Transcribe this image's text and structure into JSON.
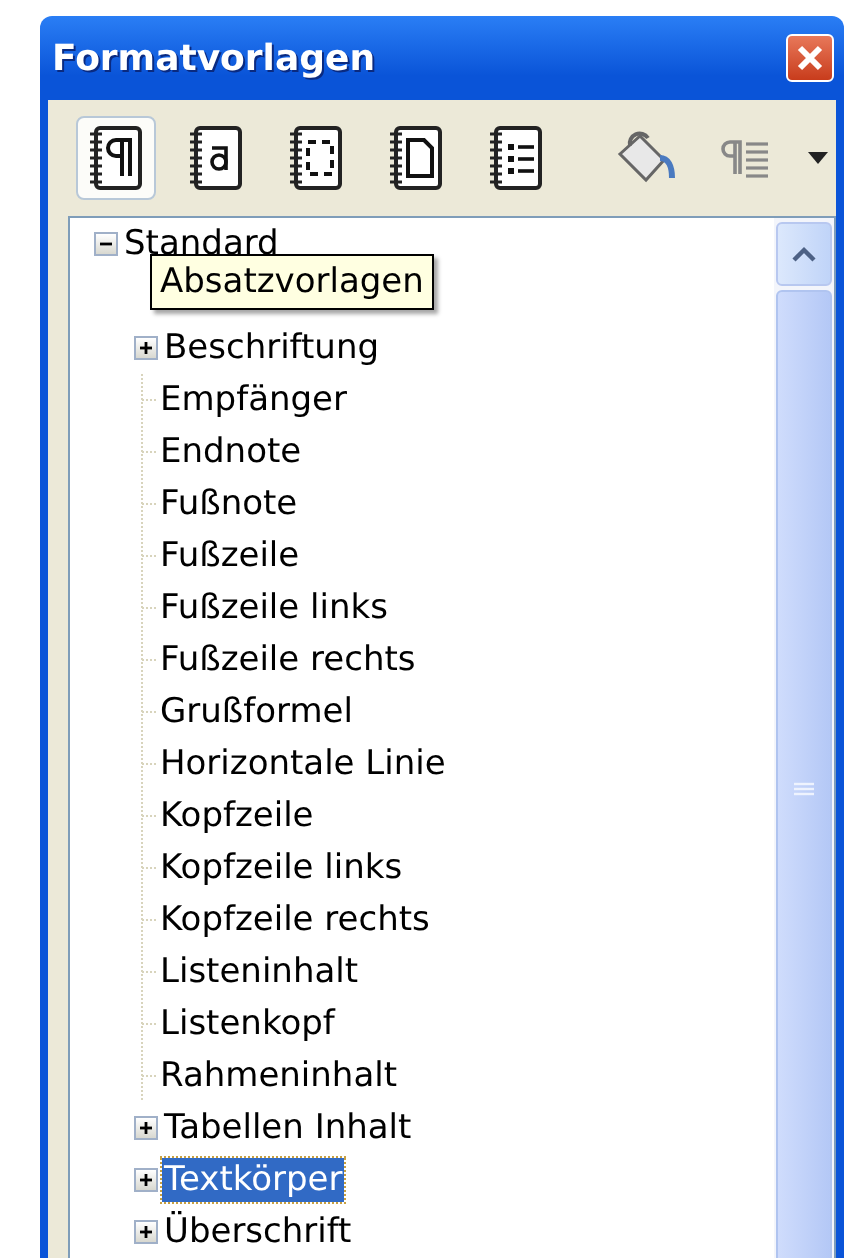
{
  "window": {
    "title": "Formatvorlagen"
  },
  "style_families": [
    {
      "kind": "paragraph",
      "selected": true
    },
    {
      "kind": "character",
      "selected": false
    },
    {
      "kind": "frame",
      "selected": false
    },
    {
      "kind": "page",
      "selected": false
    },
    {
      "kind": "list",
      "selected": false
    }
  ],
  "actions": [
    {
      "kind": "fill"
    },
    {
      "kind": "new"
    },
    {
      "kind": "menu"
    }
  ],
  "tooltip": {
    "text": "Absatzvorlagen"
  },
  "tree": [
    {
      "label": "Standard",
      "expandable": true,
      "expanded": true,
      "selected": false,
      "children": [
        {
          "label": "Beschriftung",
          "expandable": true,
          "expanded": false,
          "selected": false
        },
        {
          "label": "Empfänger",
          "expandable": false,
          "selected": false
        },
        {
          "label": "Endnote",
          "expandable": false,
          "selected": false
        },
        {
          "label": "Fußnote",
          "expandable": false,
          "selected": false
        },
        {
          "label": "Fußzeile",
          "expandable": false,
          "selected": false
        },
        {
          "label": "Fußzeile links",
          "expandable": false,
          "selected": false
        },
        {
          "label": "Fußzeile rechts",
          "expandable": false,
          "selected": false
        },
        {
          "label": "Grußformel",
          "expandable": false,
          "selected": false
        },
        {
          "label": "Horizontale Linie",
          "expandable": false,
          "selected": false
        },
        {
          "label": "Kopfzeile",
          "expandable": false,
          "selected": false
        },
        {
          "label": "Kopfzeile links",
          "expandable": false,
          "selected": false
        },
        {
          "label": "Kopfzeile rechts",
          "expandable": false,
          "selected": false
        },
        {
          "label": "Listeninhalt",
          "expandable": false,
          "selected": false
        },
        {
          "label": "Listenkopf",
          "expandable": false,
          "selected": false
        },
        {
          "label": "Rahmeninhalt",
          "expandable": false,
          "selected": false
        },
        {
          "label": "Tabellen Inhalt",
          "expandable": true,
          "expanded": false,
          "selected": false
        },
        {
          "label": "Textkörper",
          "expandable": true,
          "expanded": false,
          "selected": true
        },
        {
          "label": "Überschrift",
          "expandable": true,
          "expanded": false,
          "selected": false
        }
      ]
    }
  ]
}
